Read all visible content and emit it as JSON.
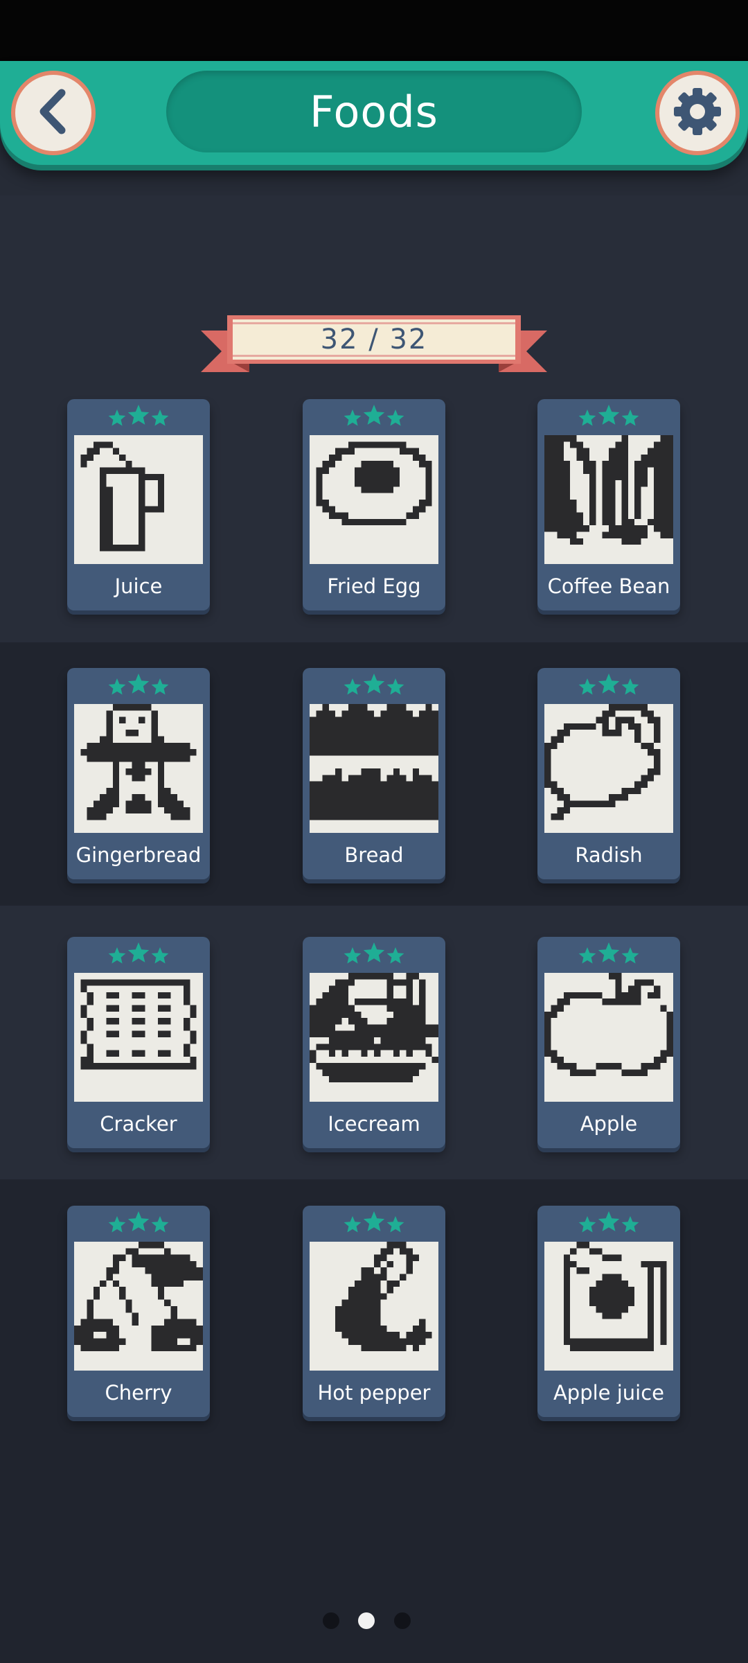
{
  "header": {
    "title": "Foods"
  },
  "progress": {
    "text": "32 / 32"
  },
  "icons": {
    "back": "back-arrow-icon",
    "settings": "gear-icon",
    "star": "star-icon"
  },
  "colors": {
    "header": "#1fae95",
    "accent_stars": "#1fae95",
    "card": "#435a79",
    "ribbon": "#f5ecd6",
    "ribbon_edge": "#d86a64"
  },
  "levels": [
    {
      "name": "Juice",
      "stars": 3,
      "pattern": [
        "....................",
        "...###..............",
        "..##..#.............",
        ".##....#............",
        ".#......#...........",
        "....#######.........",
        "....#.....####......",
        "....#.....#..#......",
        "....##....#..#......",
        "....##....#..#......",
        "....##....#..#......",
        "....##....####......",
        "....##....#.........",
        "....##....#.........",
        "....##....#.........",
        "....##....#.........",
        "....##....#.........",
        "....#######.........",
        "....................",
        "...................."
      ]
    },
    {
      "name": "Fried Egg",
      "stars": 3,
      "pattern": [
        "....................",
        "......#########.....",
        "....###.......###...",
        "...##...........##..",
        "..##....#####....##.",
        ".##....#######....#.",
        ".#.....#######....#.",
        ".#.....#######....#.",
        ".#......#####.....#.",
        ".#................#.",
        ".##..............##.",
        "..##............##..",
        "...###.........##...",
        ".....##########.....",
        "....................",
        "....................",
        "....................",
        "....................",
        "....................",
        "...................."
      ]
    },
    {
      "name": "Coffee Bean",
      "stars": 3,
      "pattern": [
        "#####.......#.....##",
        "###.##.....##....###",
        "###..##...###...####",
        "###..##...###..#####",
        "####..##.####.######",
        "####..##.####.##.###",
        "####...#.####.##.###",
        "####...#.##.#.##.###",
        "####...#.##.#.#..###",
        "####...#.##.#.#..###",
        "#####..#.##.#.#..###",
        "#####..#.##.#.#..###",
        "######.#.##.#.#..###",
        "######.#.##.##..####",
        "#######...######.###",
        "..###....#######..##",
        "....##......###.....",
        "....................",
        "....................",
        "...................."
      ]
    },
    {
      "name": "Gingerbread",
      "stars": 3,
      "pattern": [
        "......######........",
        ".....#......#.......",
        ".....#.#..#.#.......",
        ".....#......#.......",
        ".....#..##..#.......",
        "....##......##......",
        "..################..",
        ".##################.",
        "..################..",
        "......#..##..#......",
        "......#.####.#......",
        "......#..##..#......",
        "......#......#......",
        ".....##......##.....",
        "....###..##..###....",
        "...####.####.####...",
        "..####..####..####..",
        "..###..........###..",
        "....................",
        "...................."
      ]
    },
    {
      "name": "Bread",
      "stars": 3,
      "pattern": [
        "..#...###...###...#.",
        ".###.#####.#####.###",
        "####################",
        "####################",
        "####################",
        "####################",
        "####################",
        "####################",
        "....................",
        "....................",
        "....#...###..#..#...",
        "..###.#####.###.###.",
        "####################",
        "####################",
        "####################",
        "####################",
        "####################",
        "####################",
        "....................",
        "...................."
      ]
    },
    {
      "name": "Radish",
      "stars": 3,
      "pattern": [
        "..........######....",
        ".........##....##...",
        "........##.###..##..",
        "...#####.#.#.##..#..",
        "..##.....###..#..#..",
        ".##...........#..#..",
        "##.............##...",
        "#...............##..",
        "#................#..",
        "#................#..",
        "#...............##..",
        "#..............##...",
        "##............##....",
        ".##.........###.....",
        "..##......###.......",
        "...########.........",
        "..##................",
        ".##................."
      ]
    },
    {
      "name": "Cracker",
      "stars": 3,
      "pattern": [
        "....................",
        ".#################..",
        ".#...............#..",
        "..#..##..##..##..#..",
        "..#..............#..",
        ".#...##..##..##...#.",
        ".#................#.",
        "..#..##..##..##..#..",
        "..#..............#..",
        ".#...##..##..##...#.",
        ".#................#.",
        "..#..............#..",
        "..#..##..##..##..#..",
        ".##...............#.",
        ".##################.",
        "....................",
        "....................",
        "....................",
        "....................",
        "...................."
      ]
    },
    {
      "name": "Icecream",
      "stars": 3,
      "pattern": [
        "......#######..##...",
        "....###.....####.#..",
        "...###......#..#.#..",
        "..####......#..#.#..",
        ".#####.#########.#..",
        "#######.....######..",
        "########.....#####..",
        "#####.###...######..",
        "####...#############",
        "####################",
        "...#######.#######..",
        ".##################.",
        "#..#.#..#.#..#.#..#.",
        "#..................#",
        ".#################..",
        "..###############...",
        "...#############....",
        "....................",
        "....................",
        "...................."
      ]
    },
    {
      "name": "Apple",
      "stars": 3,
      "pattern": [
        "..........##........",
        "...........#..###...",
        "...........#.##..#..",
        "...######..####.##..",
        "..##.....######.....",
        ".##...............#.",
        "##.................#",
        "#..................#",
        "#..................#",
        "#..................#",
        "#..................#",
        "#..................#",
        "##................##",
        ".##..............##.",
        "..###...####...###..",
        "....####....####....",
        "....................",
        "....................",
        "....................",
        "...................."
      ]
    },
    {
      "name": "Cherry",
      "stars": 3,
      "pattern": [
        "..........####......",
        "........##....#.....",
        "......##.#########..",
        "......#..##########.",
        ".....##....#########",
        ".....#......########",
        "....#.#.....#####...",
        "...#...#.....#......",
        "...#...#.....#......",
        "..#.....#.....#.....",
        "..#.....#......#....",
        "..#......#.....#....",
        ".#####...#....#####.",
        "#######.....########",
        "###..##.....########",
        "########....####..##",
        ".######.....#######.",
        ".......................",
        "....................",
        "...................."
      ]
    },
    {
      "name": "Hot pepper",
      "stars": 3,
      "pattern": [
        "............###.....",
        "...........##.##....",
        "..........##...##...",
        "..........#.#..#....",
        "........##.#...#....",
        "........####..#.....",
        ".......####.##......",
        "......#####.#.......",
        "......######........",
        ".....######.........",
        "....#######.........",
        "....#######.........",
        "....#######......#..",
        "....########....##..",
        ".....#########.####.",
        "......############..",
        "........#######.#...",
        "....................",
        "....................",
        "...................."
      ]
    },
    {
      "name": "Apple juice",
      "stars": 3,
      "pattern": [
        ".....##.............",
        "....#..##...........",
        "...#.....###........",
        "...##..........####.",
        "...#.##.........#.#.",
        "...#.....###....#.#.",
        "...#....#####...#.#.",
        "...#...#######..#.#.",
        "...#...#######..#.#.",
        "...#...#######..#.#.",
        "...#....#####...#.#.",
        "...#.....###....#.#.",
        "...#............#.#.",
        "...#............#.#.",
        "...#............#.#.",
        "...##############.#.",
        "....#############...",
        "....................",
        "....................",
        "...................."
      ]
    }
  ],
  "pager": {
    "count": 3,
    "active": 1
  }
}
